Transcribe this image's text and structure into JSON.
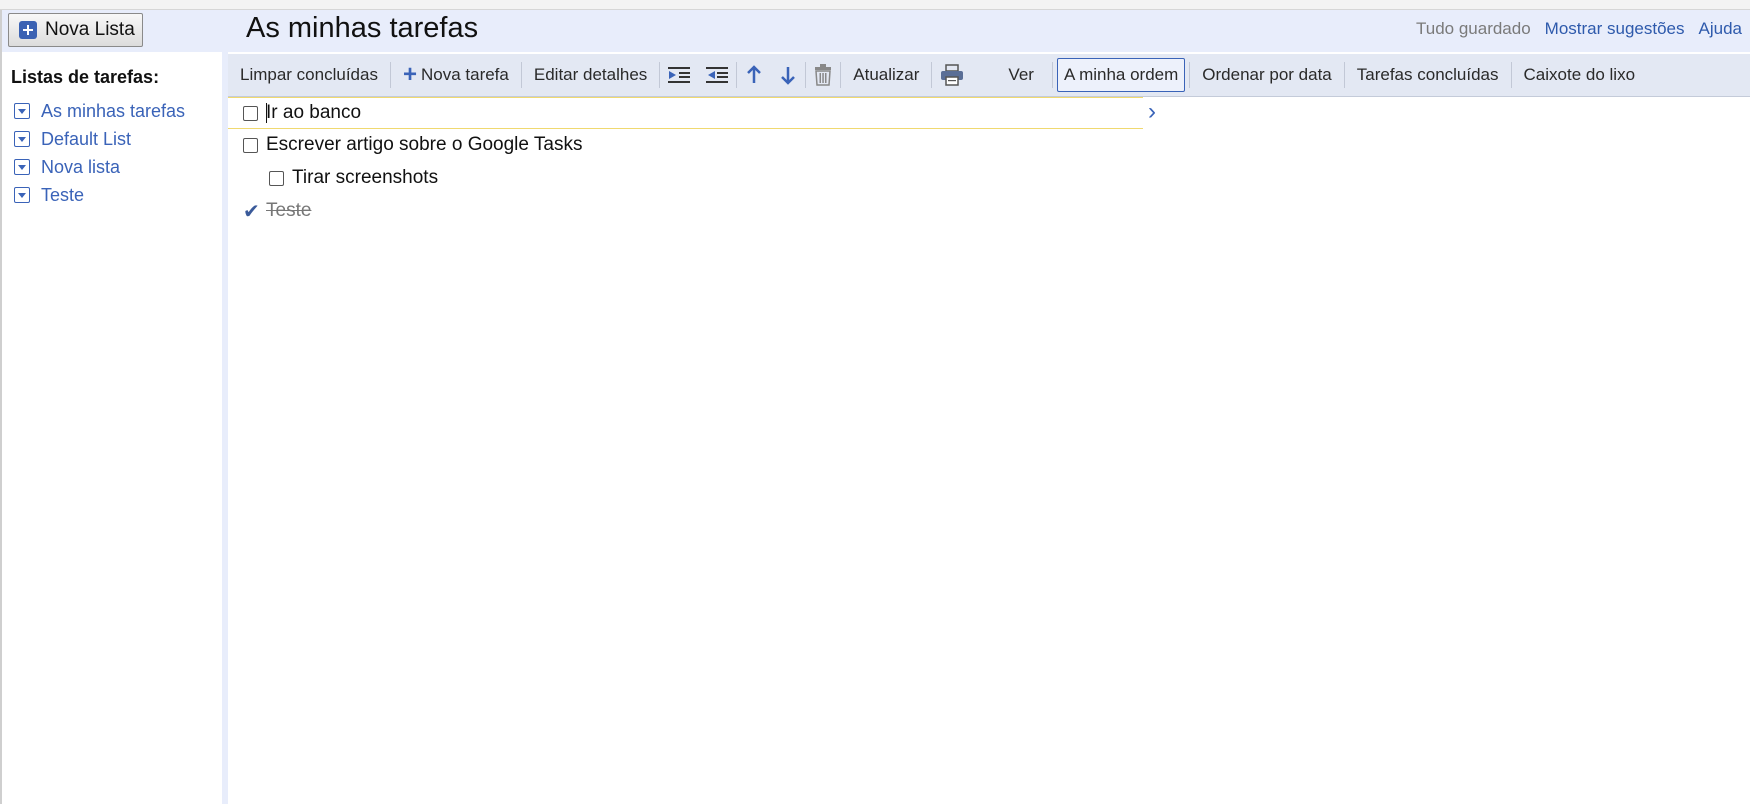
{
  "header": {
    "new_list_label": "Nova Lista",
    "title": "As minhas tarefas",
    "status": "Tudo guardado",
    "suggestions_link": "Mostrar sugestões",
    "help_link": "Ajuda"
  },
  "sidebar": {
    "title": "Listas de tarefas:",
    "items": [
      {
        "label": "As minhas tarefas"
      },
      {
        "label": "Default List"
      },
      {
        "label": "Nova lista"
      },
      {
        "label": "Teste"
      }
    ]
  },
  "toolbar": {
    "clear_completed": "Limpar concluídas",
    "new_task": "Nova tarefa",
    "edit_details": "Editar detalhes",
    "refresh": "Atualizar",
    "view": "Ver",
    "my_order": "A minha ordem",
    "sort_by_date": "Ordenar por data",
    "completed_tasks": "Tarefas concluídas",
    "trash": "Caixote do lixo"
  },
  "tasks": [
    {
      "text": "Ir ao banco",
      "completed": false,
      "indent": 0
    },
    {
      "text": "Escrever artigo sobre o Google Tasks",
      "completed": false,
      "indent": 0
    },
    {
      "text": "Tirar screenshots",
      "completed": false,
      "indent": 1
    },
    {
      "text": "Teste",
      "completed": true,
      "indent": 0
    }
  ],
  "colors": {
    "accent": "#3a63b8",
    "header_bg": "#e8edfb",
    "toolbar_bg": "#e3e8f3",
    "active_row_border": "#f0d970"
  }
}
